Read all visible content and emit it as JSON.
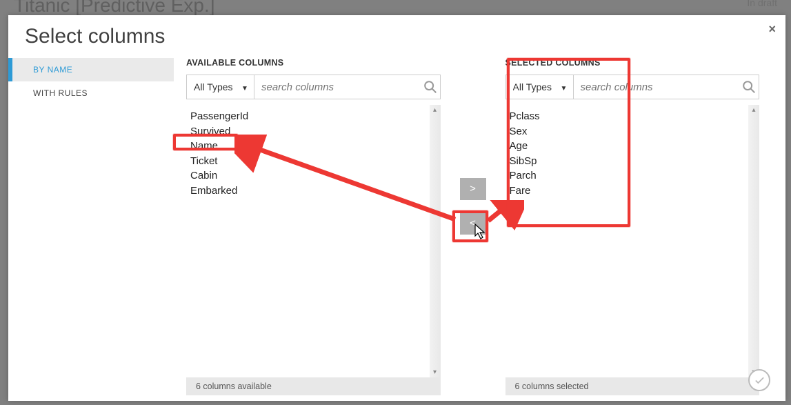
{
  "background": {
    "title": "Titanic [Predictive Exp.]",
    "status": "In draft"
  },
  "dialog": {
    "title": "Select columns",
    "close_label": "×"
  },
  "sidebar": {
    "items": [
      {
        "label": "BY NAME",
        "active": true
      },
      {
        "label": "WITH RULES",
        "active": false
      }
    ]
  },
  "available": {
    "heading": "AVAILABLE COLUMNS",
    "type_label": "All Types",
    "search_placeholder": "search columns",
    "items": [
      "PassengerId",
      "Survived",
      "Name",
      "Ticket",
      "Cabin",
      "Embarked"
    ],
    "footer": "6 columns available"
  },
  "selected": {
    "heading": "SELECTED COLUMNS",
    "type_label": "All Types",
    "search_placeholder": "search columns",
    "items": [
      "Pclass",
      "Sex",
      "Age",
      "SibSp",
      "Parch",
      "Fare"
    ],
    "footer": "6 columns selected"
  },
  "mover": {
    "right": ">",
    "left": "<"
  }
}
